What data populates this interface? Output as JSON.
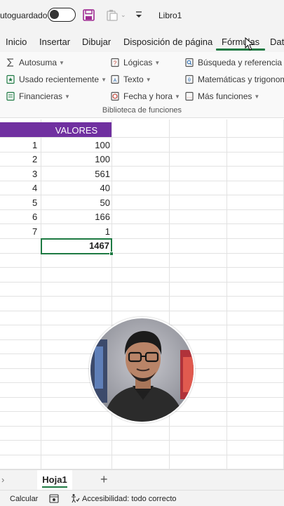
{
  "titlebar": {
    "autosave_label": "utoguardado",
    "title": "Libro1"
  },
  "ribbon_tabs": [
    "Inicio",
    "Insertar",
    "Dibujar",
    "Disposición de página",
    "Fórmulas",
    "Dat"
  ],
  "active_tab": "Fórmulas",
  "ribbon": {
    "autosuma": "Autosuma",
    "usado_recientemente": "Usado recientemente",
    "financieras": "Financieras",
    "logicas": "Lógicas",
    "texto": "Texto",
    "fecha_hora": "Fecha y hora",
    "busqueda": "Búsqueda y referencia",
    "matematicas": "Matemáticas y trigonome",
    "mas_funciones": "Más funciones",
    "group_label": "Biblioteca de funciones"
  },
  "sheet": {
    "header": "VALORES",
    "rows": [
      {
        "n": "1",
        "v": "100"
      },
      {
        "n": "2",
        "v": "100"
      },
      {
        "n": "3",
        "v": "561"
      },
      {
        "n": "4",
        "v": "40"
      },
      {
        "n": "5",
        "v": "50"
      },
      {
        "n": "6",
        "v": "166"
      },
      {
        "n": "7",
        "v": "1"
      }
    ],
    "total": "1467"
  },
  "sheet_tabs": {
    "active": "Hoja1",
    "add": "+"
  },
  "status": {
    "calc": "Calcular",
    "accessibility": "Accesibilidad: todo correcto"
  },
  "colors": {
    "header_fill": "#7030a0",
    "accent_green": "#1e7a43",
    "save_icon": "#a02b93"
  }
}
